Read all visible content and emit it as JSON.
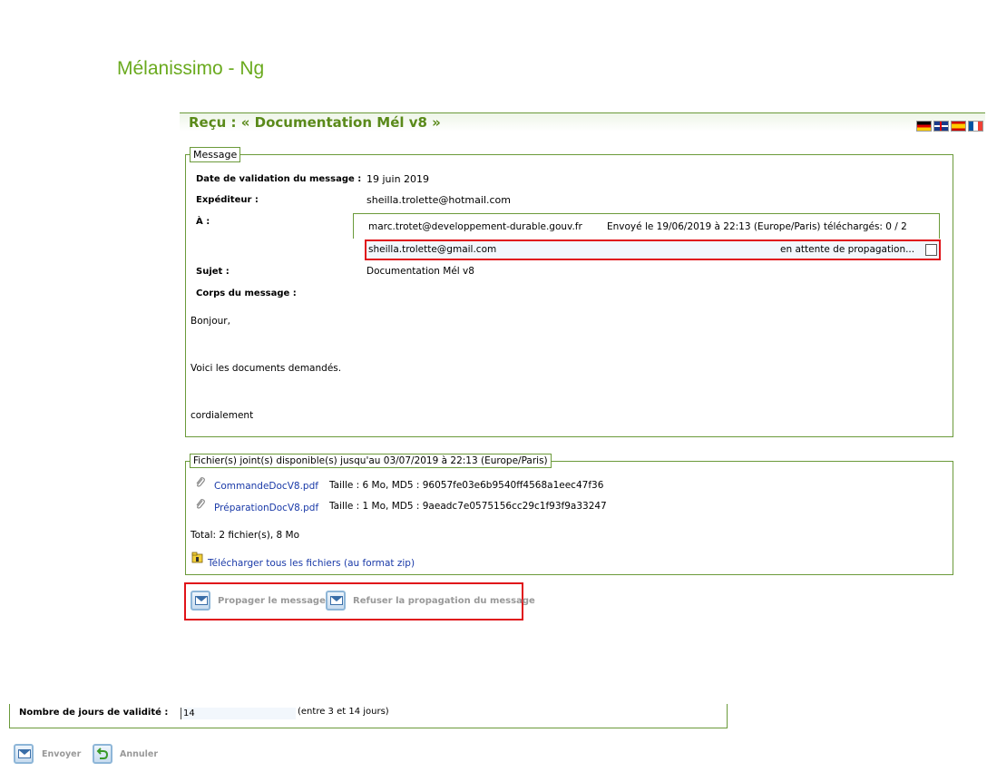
{
  "app": {
    "title": "Mélanissimo - Ng"
  },
  "header": {
    "title": "Reçu : « Documentation Mél v8 »",
    "flags": [
      "de",
      "gb",
      "es",
      "fr"
    ]
  },
  "message": {
    "legend": "Message",
    "date_label": "Date de validation du message :",
    "date_value": "19 juin 2019",
    "sender_label": "Expéditeur :",
    "sender_value": "sheilla.trolette@hotmail.com",
    "to_label": "À :",
    "recipients": [
      {
        "email": "marc.trotet@developpement-durable.gouv.fr",
        "status": "Envoyé le 19/06/2019 à 22:13 (Europe/Paris) téléchargés: 0 / 2"
      },
      {
        "email": "sheilla.trolette@gmail.com",
        "status": "en attente de propagation..."
      }
    ],
    "subject_label": "Sujet :",
    "subject_value": "Documentation Mél v8",
    "body_label": "Corps du message :",
    "body_lines": [
      "Bonjour,",
      "Voici les documents demandés.",
      "cordialement"
    ]
  },
  "files": {
    "legend": "Fichier(s) joint(s) disponible(s) jusqu'au 03/07/2019 à 22:13 (Europe/Paris)",
    "items": [
      {
        "name": "CommandeDocV8.pdf",
        "info": "Taille : 6 Mo, MD5 : 96057fe03e6b9540ff4568a1eec47f36"
      },
      {
        "name": "PréparationDocV8.pdf",
        "info": "Taille : 1 Mo, MD5 : 9aeadc7e0575156cc29c1f93f9a33247"
      }
    ],
    "total": "Total: 2 fichier(s), 8 Mo",
    "download_all": "Télécharger tous les fichiers (au format zip)"
  },
  "actions": {
    "propagate": "Propager le message",
    "refuse": "Refuser la propagation du message"
  },
  "validity": {
    "label": "Nombre de jours de validité :",
    "value": "14",
    "hint": "(entre 3 et 14 jours)"
  },
  "footer": {
    "send": "Envoyer",
    "cancel": "Annuler"
  }
}
